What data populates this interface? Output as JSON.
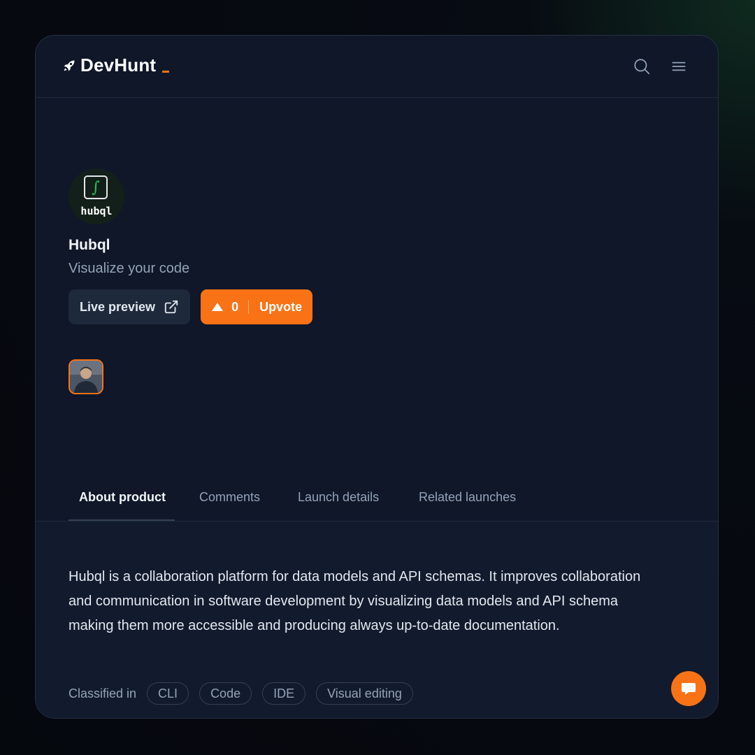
{
  "header": {
    "logo_text": "DevHunt",
    "logo_icon": "rocket-icon",
    "search_icon": "search-icon",
    "menu_icon": "hamburger-menu-icon"
  },
  "product": {
    "logo_word": "hubql",
    "logo_glyph": "∫",
    "name": "Hubql",
    "tagline": "Visualize your code",
    "live_preview_label": "Live preview",
    "upvote_count": "0",
    "upvote_label": "Upvote"
  },
  "tabs": [
    {
      "label": "About product",
      "active": true
    },
    {
      "label": "Comments",
      "active": false
    },
    {
      "label": "Launch details",
      "active": false
    },
    {
      "label": "Related launches",
      "active": false
    }
  ],
  "about": {
    "description": "Hubql is a collaboration platform for data models and API schemas. It improves collaboration and communication in software development by visualizing data models and API schema making them more accessible and producing always up-to-date documentation.",
    "classified_label": "Classified in",
    "tags": [
      "CLI",
      "Code",
      "IDE",
      "Visual editing"
    ]
  },
  "colors": {
    "accent": "#f97316",
    "background": "#0f1729",
    "logo_accent": "#22c55e"
  }
}
